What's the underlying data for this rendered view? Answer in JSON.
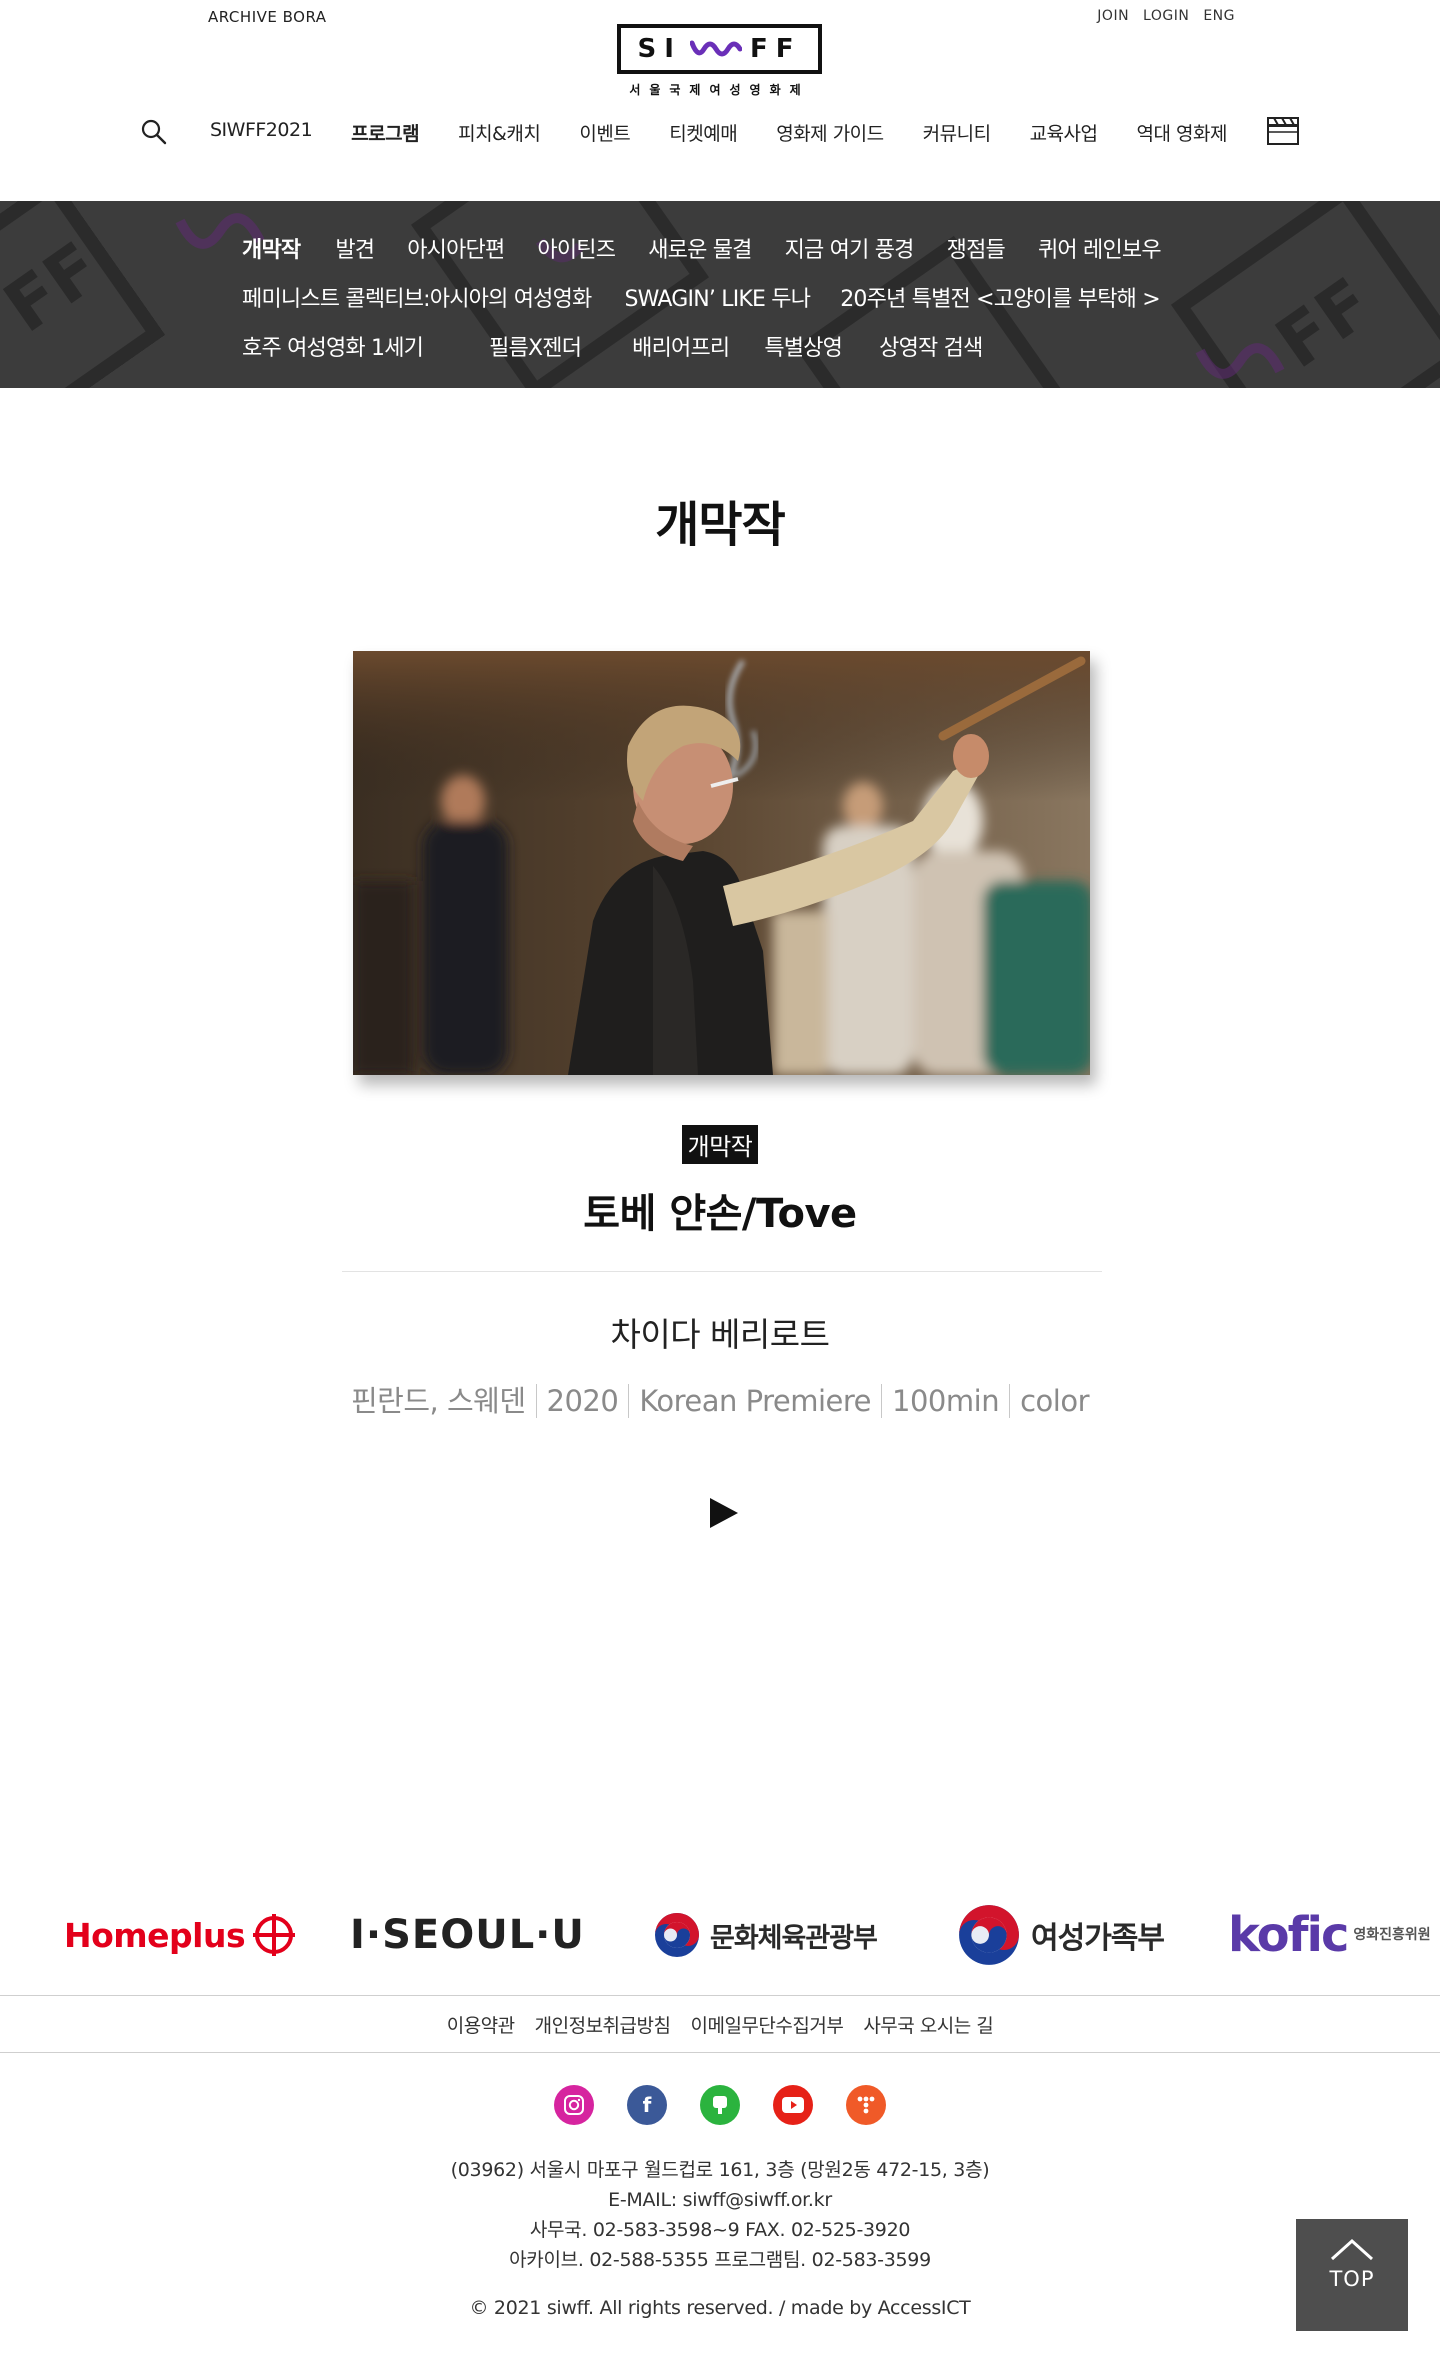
{
  "header": {
    "archive_link": "ARCHIVE BORA",
    "util_links": [
      "JOIN",
      "LOGIN",
      "ENG"
    ],
    "logo": {
      "text_left": "SI",
      "text_right": "FF",
      "subtitle": "서울국제여성영화제"
    },
    "gnb": [
      "SIWFF2021",
      "프로그램",
      "피치&캐치",
      "이벤트",
      "티켓예매",
      "영화제 가이드",
      "커뮤니티",
      "교육사업",
      "역대 영화제"
    ],
    "gnb_active": "프로그램"
  },
  "subnav": {
    "row1": [
      "개막작",
      "발견",
      "아시아단편",
      "아이틴즈",
      "새로운 물결",
      "지금 여기 풍경",
      "쟁점들",
      "퀴어 레인보우"
    ],
    "row2": [
      "페미니스트 콜렉티브:아시아의 여성영화",
      "SWAGIN’ LIKE 두나",
      "20주년 특별전 <고양이를 부탁해 >"
    ],
    "row3": [
      "호주 여성영화 1세기",
      "필름X젠더",
      "배리어프리",
      "특별상영",
      "상영작 검색"
    ],
    "active": "개막작"
  },
  "main": {
    "page_title": "개막작",
    "badge": "개막작",
    "film_title": "토베 얀손/Tove",
    "director": "차이다 베리로트",
    "meta": [
      "핀란드, 스웨덴",
      "2020",
      "Korean Premiere",
      "100min",
      "color"
    ]
  },
  "sponsors": {
    "homeplus": "Homeplus",
    "seoul": "I·SEOUL·U",
    "mcst": "문화체육관광부",
    "mogef": "여성가족부",
    "kofic": "kofic",
    "kofic_sub": "영화진흥위원"
  },
  "footer": {
    "links": [
      "이용약관",
      "개인정보취급방침",
      "이메일무단수집거부",
      "사무국 오시는 길"
    ],
    "address": [
      "(03962) 서울시 마포구 월드컵로 161, 3층 (망원2동 472-15, 3층)",
      "E-MAIL: siwff@siwff.or.kr",
      "사무국. 02-583-3598~9 FAX. 02-525-3920",
      "아카이브. 02-588-5355 프로그램팀. 02-583-3599"
    ],
    "copyright": "© 2021 siwff. All rights reserved. / made by AccessICT",
    "top_label": "TOP"
  },
  "colors": {
    "subnav_bg": "#3c3c3c",
    "homeplus": "#e3001b",
    "kofic": "#5a3aa8",
    "top_btn": "#4e4e4e"
  }
}
